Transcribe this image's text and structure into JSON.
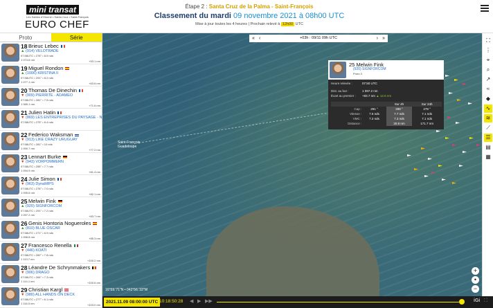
{
  "header": {
    "logo_top": "mini transat",
    "logo_sub": "Les Sables d'Olonne • Santa Cruz • Saint-François",
    "logo_bottom": "EURO CHEF",
    "stage_prefix": "Étape 2 :",
    "stage_route": "Santa Cruz de la Palma - Saint-François",
    "ranking_prefix": "Classement du mardi",
    "ranking_date": "09 novembre 2021 à 08h00 UTC",
    "update_text": "Mise à jour toutes les 4 heures | Prochain relevé à",
    "next_time": "12h00",
    "update_suffix": "UTC"
  },
  "tabs": [
    {
      "label": "Proto",
      "active": false
    },
    {
      "label": "Série",
      "active": true
    }
  ],
  "competitors": [
    {
      "rank": "18",
      "name": "Brieuc Lebec",
      "flag": "fr",
      "boat": "(914) VELOTRADE",
      "trend": "up",
      "line1": "07:58UTC • 276° • 8.5 nds",
      "line2": "1 074.6 nm",
      "dist": "+53.1 nm"
    },
    {
      "rank": "19",
      "name": "Miguel Rondon",
      "flag": "es",
      "boat": "(1006) KRISTINA II",
      "trend": "up",
      "line1": "07:58UTC • 291° • 8.2 nds",
      "line2": "1 077.1 nm",
      "dist": "+63.6 nm"
    },
    {
      "rank": "20",
      "name": "Thomas De Dinechin",
      "flag": "fr",
      "boat": "(909) PIERRITE - ADAMEO",
      "trend": "down",
      "line1": "07:58UTC • 281° • 7.5 nds",
      "line2": "1 085.1 nm",
      "dist": "+71.6 nm"
    },
    {
      "rank": "21",
      "name": "Julien Hatin",
      "flag": "fr",
      "boat": "(869) LES ENTREPRISES DU PAYSAGE - NORMANDIE",
      "trend": "down",
      "line1": "07:58UTC • 275° • 6.4 nds",
      "line2": "",
      "dist": ""
    },
    {
      "rank": "22",
      "name": "Federico Waksman",
      "flag": "uy",
      "boat": "(913) LIKE CRAZY URUGUAY",
      "trend": "down",
      "line1": "07:58UTC • 281° • 10 nds",
      "line2": "1 090.7 nm",
      "dist": "+77.2 nm"
    },
    {
      "rank": "23",
      "name": "Lennart Burke",
      "flag": "de",
      "boat": "(943) VORPOMMERN",
      "trend": "down",
      "line1": "07:58UTC • 255° • 7.7 nds",
      "line2": "1 094.9 nm",
      "dist": "+81.4 nm"
    },
    {
      "rank": "24",
      "name": "Julie Simon",
      "flag": "fr",
      "boat": "(963) DynaMIPS",
      "trend": "down",
      "line1": "07:58UTC • 276° • 7.0 nds",
      "line2": "1 095.6 nm",
      "dist": "+82.1 nm"
    },
    {
      "rank": "25",
      "name": "Melwin Fink",
      "flag": "de",
      "boat": "(920) SIGNFORCOM",
      "trend": "up",
      "line1": "07:58UTC • 291° • 7.2 nds",
      "line2": "1 097.2 nm",
      "dist": "+83.7 nm"
    },
    {
      "rank": "26",
      "name": "Genis Hontoria Nogueroles",
      "flag": "es",
      "boat": "(810) BLUE OSCAR",
      "trend": "up",
      "line1": "07:58UTC • 271° • 6.9 nds",
      "line2": "1 098.8 nm",
      "dist": "+85.3 nm"
    },
    {
      "rank": "27",
      "name": "Francesco Renella",
      "flag": "it",
      "boat": "(446) KOATI",
      "trend": "down",
      "line1": "07:58UTC • 282° • 7.8 nds",
      "line2": "1 113.7 nm",
      "dist": "+100.2 nm"
    },
    {
      "rank": "28",
      "name": "Léandre De Schrynmakers",
      "flag": "be",
      "boat": "(906) DRAGO",
      "trend": "down",
      "line1": "07:58UTC • 264° • 7.3 nds",
      "line2": "1 114.1 nm",
      "dist": "+100.6 nm"
    },
    {
      "rank": "29",
      "name": "Christian Kargl",
      "flag": "at",
      "boat": "(980) ALL HANDS ON DECK",
      "trend": "down",
      "line1": "07:58UTC • 277° • 6.1 nds",
      "line2": "1 116.5 nm",
      "dist": "+103.0 nm"
    }
  ],
  "map": {
    "time_label": "+03h : 09/11 09h UTC",
    "place_label_1": "Saint-François",
    "place_label_2": "Guadeloupe",
    "coords": "16°59.'71\"N • 042°56.'33\"W"
  },
  "popup": {
    "rank": "25",
    "name": "Melwin Fink",
    "boat": "(920) SIGNFORCOM",
    "sub": "Proto 3",
    "heure_label": "Heure relevée :",
    "heure_value": "07:50 UTC",
    "dist_label": "Dist. au but :",
    "dist_value": "1 097.2 nm",
    "ecart_label": "Écart au premier :",
    "ecart_value": "+83.7 nm",
    "ecart_extra": "▲ 12.8 nm",
    "cols": [
      "",
      "",
      "Sur 4h",
      "Sur 24h"
    ],
    "rows": [
      {
        "k": "Cap :",
        "a": "291 °",
        "b": "288 °",
        "c": "278 °"
      },
      {
        "k": "Vitesse :",
        "a": "7.6 nds",
        "b": "7.7 nds",
        "c": "7.1 nds"
      },
      {
        "k": "VMC :",
        "a": "7.2 nds",
        "b": "7.3 nds",
        "c": "7.1 nds"
      },
      {
        "k": "Distance :",
        "a": "",
        "b": "30.8 nm",
        "c": "171.7 nm"
      }
    ]
  },
  "bottom": {
    "datetime": "2021.11.09 08:00:00 UTC",
    "clock": "10:18:50:28",
    "brand": "iGi"
  },
  "colors": {
    "accent": "#f5e600",
    "title_blue": "#1f3d6b",
    "date_blue": "#1a8fd1",
    "boat_blue": "#1a6ad1"
  }
}
